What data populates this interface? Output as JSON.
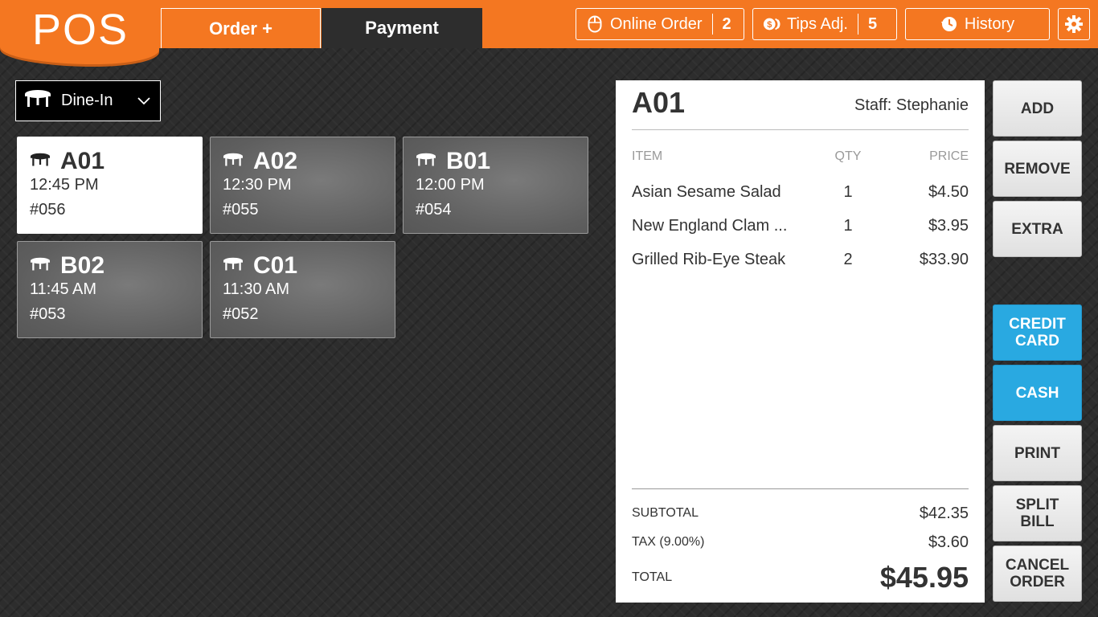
{
  "app": {
    "logo": "POS"
  },
  "tabs": {
    "order": "Order +",
    "payment": "Payment"
  },
  "header": {
    "online_order": {
      "label": "Online Order",
      "count": "2",
      "icon": "mouse-icon"
    },
    "tips_adj": {
      "label": "Tips Adj.",
      "count": "5",
      "icon": "coins-icon"
    },
    "history": {
      "label": "History",
      "icon": "clock-history-icon"
    },
    "settings": {
      "icon": "gear-icon"
    }
  },
  "dine_select": {
    "value": "Dine-In"
  },
  "tables": [
    {
      "name": "A01",
      "time": "12:45 PM",
      "number": "#056",
      "active": true
    },
    {
      "name": "A02",
      "time": "12:30 PM",
      "number": "#055",
      "active": false
    },
    {
      "name": "B01",
      "time": "12:00 PM",
      "number": "#054",
      "active": false
    },
    {
      "name": "B02",
      "time": "11:45 AM",
      "number": "#053",
      "active": false
    },
    {
      "name": "C01",
      "time": "11:30 AM",
      "number": "#052",
      "active": false
    }
  ],
  "receipt": {
    "table": "A01",
    "staff": "Staff: Stephanie",
    "columns": {
      "item": "ITEM",
      "qty": "QTY",
      "price": "PRICE"
    },
    "items": [
      {
        "name": "Asian Sesame Salad",
        "qty": "1",
        "price": "$4.50"
      },
      {
        "name": "New England Clam ...",
        "qty": "1",
        "price": "$3.95"
      },
      {
        "name": "Grilled Rib-Eye Steak",
        "qty": "2",
        "price": "$33.90"
      }
    ],
    "subtotal_label": "SUBTOTAL",
    "subtotal": "$42.35",
    "tax_label": "TAX (9.00%)",
    "tax": "$3.60",
    "total_label": "TOTAL",
    "total": "$45.95"
  },
  "actions": {
    "add": "ADD",
    "remove": "REMOVE",
    "extra": "EXTRA",
    "credit_card": "CREDIT CARD",
    "cash": "CASH",
    "print": "PRINT",
    "split_bill": "SPLIT BILL",
    "cancel_order": "CANCEL ORDER"
  },
  "colors": {
    "brand": "#f47721",
    "accent": "#29a9e1",
    "background": "#2d2d2d"
  }
}
